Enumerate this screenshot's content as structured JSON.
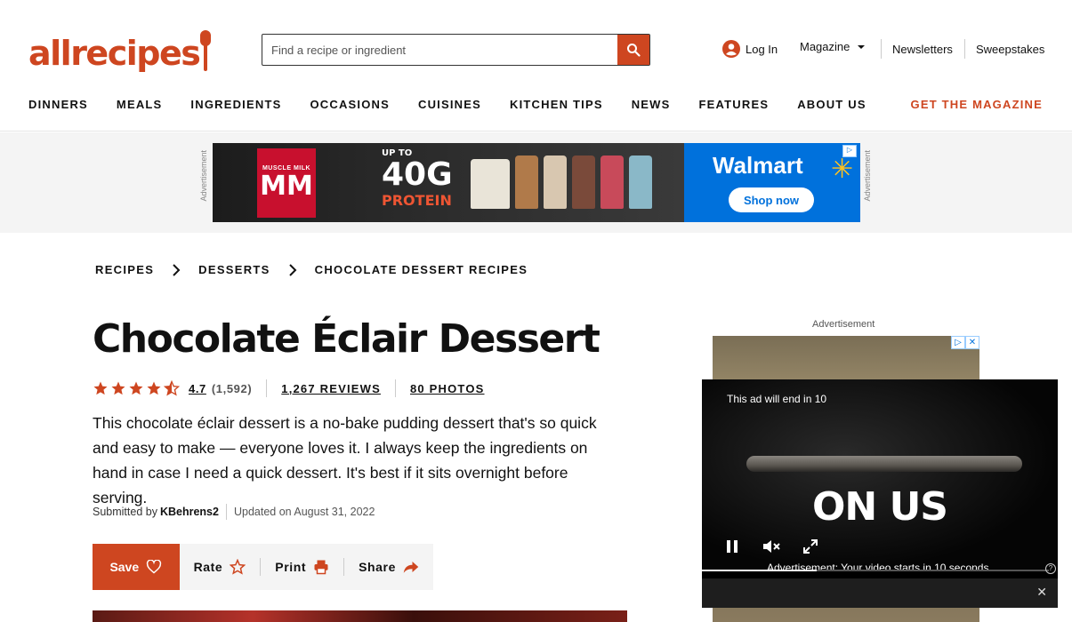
{
  "header": {
    "logo": "allrecipes",
    "search_placeholder": "Find a recipe or ingredient",
    "login": "Log In",
    "magazine": "Magazine",
    "newsletters": "Newsletters",
    "sweepstakes": "Sweepstakes",
    "get_magazine": "GET THE MAGAZINE"
  },
  "nav": [
    "DINNERS",
    "MEALS",
    "INGREDIENTS",
    "OCCASIONS",
    "CUISINES",
    "KITCHEN TIPS",
    "NEWS",
    "FEATURES",
    "ABOUT US"
  ],
  "ad_banner": {
    "label": "Advertisement",
    "brand_small": "MUSCLE MILK",
    "brand_logo": "MM",
    "upto": "UP TO",
    "protein_num": "40G",
    "protein_word": "PROTEIN",
    "walmart": "Walmart",
    "shop_now": "Shop now"
  },
  "breadcrumb": [
    "RECIPES",
    "DESSERTS",
    "CHOCOLATE DESSERT RECIPES"
  ],
  "recipe": {
    "title": "Chocolate Éclair Dessert",
    "rating": 4.7,
    "rating_text": "4.7",
    "rating_count": "(1,592)",
    "reviews": "1,267 REVIEWS",
    "photos": "80 PHOTOS",
    "description": "This chocolate éclair dessert is a no-bake pudding dessert that's so quick and easy to make — everyone loves it. I always keep the ingredients on hand in case I need a quick dessert. It's best if it sits overnight before serving.",
    "submitted_label": "Submitted by",
    "author": "KBehrens2",
    "updated": "Updated on August 31, 2022"
  },
  "actions": {
    "save": "Save",
    "rate": "Rate",
    "print": "Print",
    "share": "Share"
  },
  "rail": {
    "ad_label": "Advertisement"
  },
  "video": {
    "ad_countdown": "This ad will end in 10",
    "headline": "ON US",
    "message": "Advertisement: Your video starts in 10 seconds.",
    "progress": 0.33
  },
  "colors": {
    "brand": "#ce4620",
    "walmart_blue": "#0071dc",
    "walmart_yellow": "#ffc220"
  }
}
